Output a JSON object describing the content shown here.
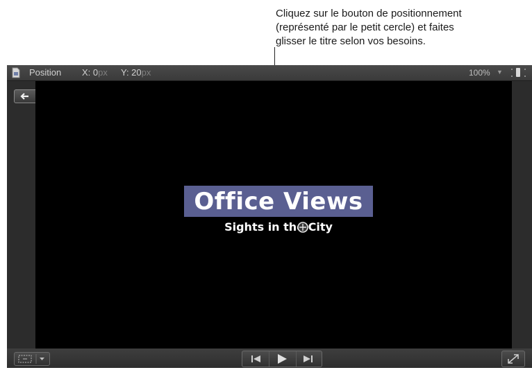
{
  "callout": {
    "lines": [
      "Cliquez sur le bouton de positionnement",
      "(représenté par le petit cercle) et faites",
      "glisser le titre selon vos besoins."
    ]
  },
  "viewer": {
    "mode_label": "Position",
    "x_label": "X: 0",
    "x_unit": "px",
    "y_label": "Y: 20",
    "y_unit": "px",
    "zoom": "100%",
    "canvas": {
      "title": "Office Views",
      "subtitle": "Sights in the City",
      "title_highlight_color": "#5a5f91"
    }
  },
  "icons": {
    "document": "document-icon",
    "back": "arrow-left-icon",
    "forward": "arrow-right-icon",
    "zoom_dropdown": "chevron-down-icon",
    "view_toggle": "view-layout-icon",
    "position_handle": "position-handle-icon",
    "transform": "transform-icon",
    "prev": "skip-back-icon",
    "play": "play-icon",
    "next": "skip-forward-icon",
    "fullscreen": "fullscreen-icon"
  }
}
